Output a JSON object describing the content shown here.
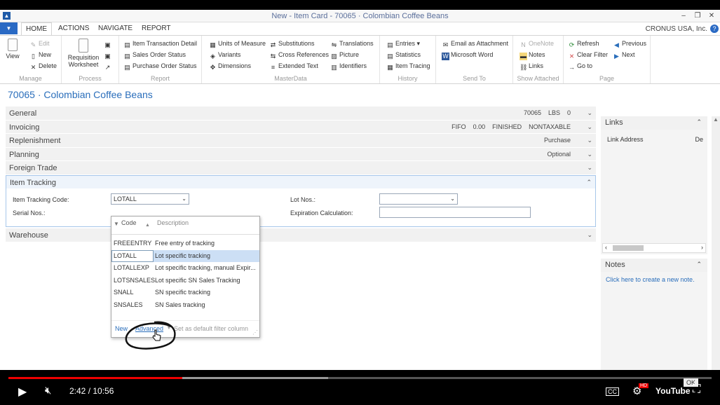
{
  "window": {
    "title": "New - Item Card - 70065 · Colombian Coffee Beans",
    "app_icon": "nav-logo-icon",
    "minimize": "–",
    "restore": "❐",
    "close": "✕"
  },
  "ribbon_tabs": [
    "HOME",
    "ACTIONS",
    "NAVIGATE",
    "REPORT"
  ],
  "app_menu_glyph": "▼",
  "company": "CRONUS USA, Inc.",
  "help_glyph": "?",
  "ribbon": {
    "manage": {
      "label": "Manage",
      "view": "View",
      "edit": "Edit",
      "new": "New",
      "delete": "Delete"
    },
    "process": {
      "label": "Process",
      "requisition": "Requisition Worksheet"
    },
    "report": {
      "label": "Report",
      "items": [
        "Item Transaction Detail",
        "Sales Order Status",
        "Purchase Order Status"
      ]
    },
    "masterdata": {
      "label": "MasterData",
      "items": [
        "Units of Measure",
        "Variants",
        "Dimensions",
        "Substitutions",
        "Cross References",
        "Extended Text",
        "Translations",
        "Picture",
        "Identifiers"
      ]
    },
    "history": {
      "label": "History",
      "items": [
        "Entries",
        "Statistics",
        "Item Tracing"
      ]
    },
    "sendto": {
      "label": "Send To",
      "items": [
        "Email as Attachment",
        "Microsoft Word"
      ]
    },
    "attached": {
      "label": "Show Attached",
      "items": [
        "OneNote",
        "Notes",
        "Links"
      ]
    },
    "page": {
      "label": "Page",
      "items": [
        "Refresh",
        "Clear Filter",
        "Go to",
        "Previous",
        "Next"
      ]
    }
  },
  "page_title": "70065 · Colombian Coffee Beans",
  "fasttabs": [
    {
      "label": "General",
      "summary": [
        "70065",
        "LBS",
        "0"
      ]
    },
    {
      "label": "Invoicing",
      "summary": [
        "FIFO",
        "0.00",
        "FINISHED",
        "NONTAXABLE"
      ]
    },
    {
      "label": "Replenishment",
      "summary": [
        "Purchase"
      ]
    },
    {
      "label": "Planning",
      "summary": [
        "Optional"
      ]
    },
    {
      "label": "Foreign Trade",
      "summary": []
    },
    {
      "label": "Item Tracking",
      "summary": []
    },
    {
      "label": "Warehouse",
      "summary": []
    }
  ],
  "item_tracking": {
    "code_label": "Item Tracking Code:",
    "code_value": "LOTALL",
    "serial_label": "Serial Nos.:",
    "lot_label": "Lot Nos.:",
    "lot_value": "",
    "expiration_label": "Expiration Calculation:",
    "expiration_value": ""
  },
  "lookup": {
    "col_code": "Code",
    "col_desc": "Description",
    "rows": [
      {
        "code": "FREEENTRY",
        "desc": "Free entry of tracking"
      },
      {
        "code": "LOTALL",
        "desc": "Lot specific tracking"
      },
      {
        "code": "LOTALLEXP",
        "desc": "Lot specific tracking, manual Expir..."
      },
      {
        "code": "LOTSNSALES",
        "desc": "Lot specific SN Sales Tracking"
      },
      {
        "code": "SNALL",
        "desc": "SN specific tracking"
      },
      {
        "code": "SNSALES",
        "desc": "SN Sales tracking"
      }
    ],
    "selected_index": 1,
    "new": "New",
    "advanced": "Advanced",
    "default_filter": "Set as default filter column"
  },
  "factbox": {
    "links": {
      "title": "Links",
      "col_address": "Link Address",
      "col_de": "De"
    },
    "notes": {
      "title": "Notes",
      "link": "Click here to create a new note."
    }
  },
  "player": {
    "time": "2:42 / 10:56",
    "progress": 0.247,
    "ok": "OK",
    "cc": "CC",
    "hd": "HD",
    "youtube": "YouTube",
    "accent": "#ee0000"
  },
  "colors": {
    "link": "#2a6ebb",
    "selection": "#ccdff5",
    "focus_border": "#a7c7ea"
  }
}
